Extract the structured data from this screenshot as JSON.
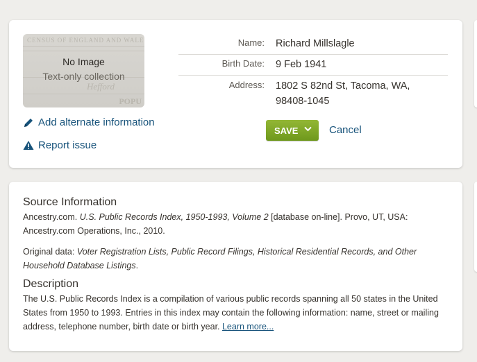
{
  "record": {
    "image": {
      "bg_text_1": "CENSUS OF ENGLAND AND WALES",
      "bg_text_2": "Hefford",
      "bg_text_3": "POPU",
      "no_image": "No Image",
      "collection_type": "Text-only collection"
    },
    "actions": {
      "alt_info": "Add alternate information",
      "report": "Report issue"
    },
    "fields": {
      "name_label": "Name:",
      "name_value": "Richard Millslagle",
      "birth_label": "Birth Date:",
      "birth_value": "9 Feb 1941",
      "address_label": "Address:",
      "address_value": "1802 S 82nd St, Tacoma, WA, 98408-1045"
    },
    "save_label": "SAVE",
    "cancel_label": "Cancel"
  },
  "source": {
    "heading": "Source Information",
    "citation_prefix": "Ancestry.com. ",
    "citation_title": "U.S. Public Records Index, 1950-1993, Volume 2",
    "citation_suffix": " [database on-line]. Provo, UT, USA: Ancestry.com Operations, Inc., 2010.",
    "original_prefix": "Original data: ",
    "original_data": "Voter Registration Lists, Public Record Filings, Historical Residential Records, and Other Household Database Listings",
    "original_suffix": ".",
    "description_heading": "Description",
    "description_text": "The U.S. Public Records Index is a compilation of various public records spanning all 50 states in the United States from 1950 to 1993. Entries in this index may contain the following information: name, street or mailing address, telephone number, birth date or birth year. ",
    "learn_more": "Learn more..."
  },
  "colors": {
    "link": "#16527a",
    "save_button": "#7fa829",
    "background": "#efeeeb"
  }
}
